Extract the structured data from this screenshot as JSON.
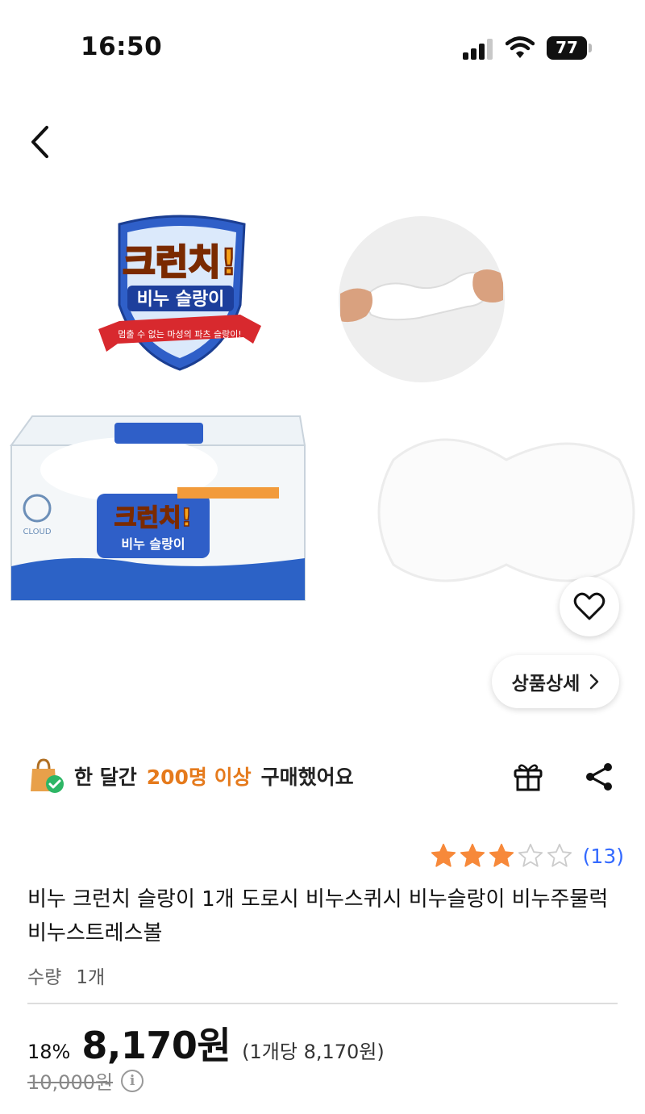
{
  "status_bar": {
    "time": "16:50",
    "battery": "77",
    "icons": [
      "signal-icon",
      "wifi-icon",
      "battery-icon"
    ]
  },
  "nav": {
    "back_icon": "chevron-left-icon"
  },
  "gallery": {
    "logo": {
      "title": "크런치!",
      "subtitle": "비누 슬랑이",
      "ribbon": "멈출 수 없는 마성의 파츠 슬랑이!"
    },
    "package": {
      "brand": "CLOUD",
      "title": "크런치!",
      "subtitle": "비누 슬랑이"
    },
    "wishlist_icon": "heart-outline-icon",
    "detail_button": {
      "label": "상품상세",
      "icon": "chevron-right-icon"
    }
  },
  "purchase_info": {
    "icon": "shopping-bag-check-icon",
    "prefix": "한 달간",
    "highlight": "200명 이상",
    "suffix": "구매했어요"
  },
  "actions": {
    "gift_icon": "gift-icon",
    "share_icon": "share-icon"
  },
  "rating": {
    "value": 3,
    "max": 5,
    "review_count": "(13)",
    "filled_color": "#f7893a",
    "empty_color": "#cccccc"
  },
  "product": {
    "title": "비누 크런치 슬랑이 1개 도로시 비누스퀴시 비누슬랑이 비누주물럭 비누스트레스볼",
    "quantity_label": "수량",
    "quantity_value": "1개"
  },
  "price": {
    "discount": "18%",
    "sale": "8,170원",
    "unit": "(1개당 8,170원)",
    "original": "10,000원",
    "info_icon": "info-icon"
  },
  "colors": {
    "accent": "#e57a1c",
    "link": "#346aff"
  }
}
